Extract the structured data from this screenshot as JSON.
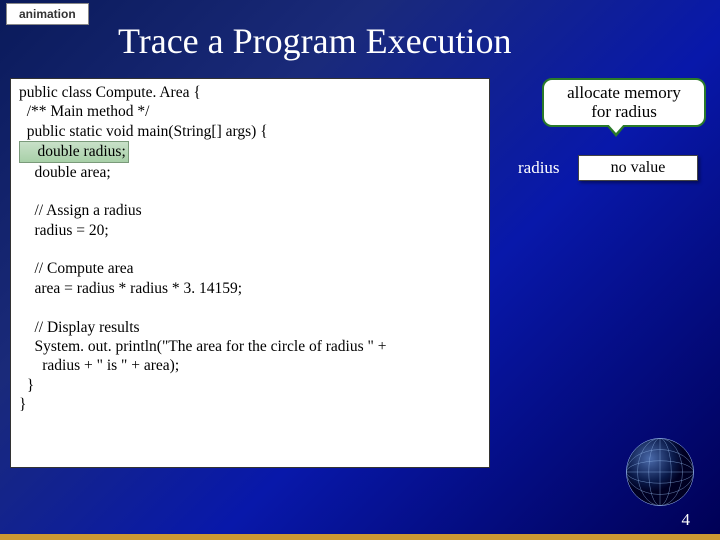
{
  "tag": "animation",
  "title": "Trace a Program Execution",
  "callout": {
    "line1": "allocate memory",
    "line2": "for radius"
  },
  "var": {
    "name": "radius",
    "value": "no value"
  },
  "code": {
    "l1": "public class Compute. Area {",
    "l2": "  /** Main method */",
    "l3": "  public static void main(String[] args) {",
    "l4_hl": "    double radius;",
    "l5": "    double area;",
    "blank1": " ",
    "l6": "    // Assign a radius",
    "l7": "    radius = 20;",
    "blank2": " ",
    "l8": "    // Compute area",
    "l9": "    area = radius * radius * 3. 14159;",
    "blank3": " ",
    "l10": "    // Display results",
    "l11": "    System. out. println(\"The area for the circle of radius \" +",
    "l12": "      radius + \" is \" + area);",
    "l13": "  }",
    "l14": "}"
  },
  "page": "4"
}
